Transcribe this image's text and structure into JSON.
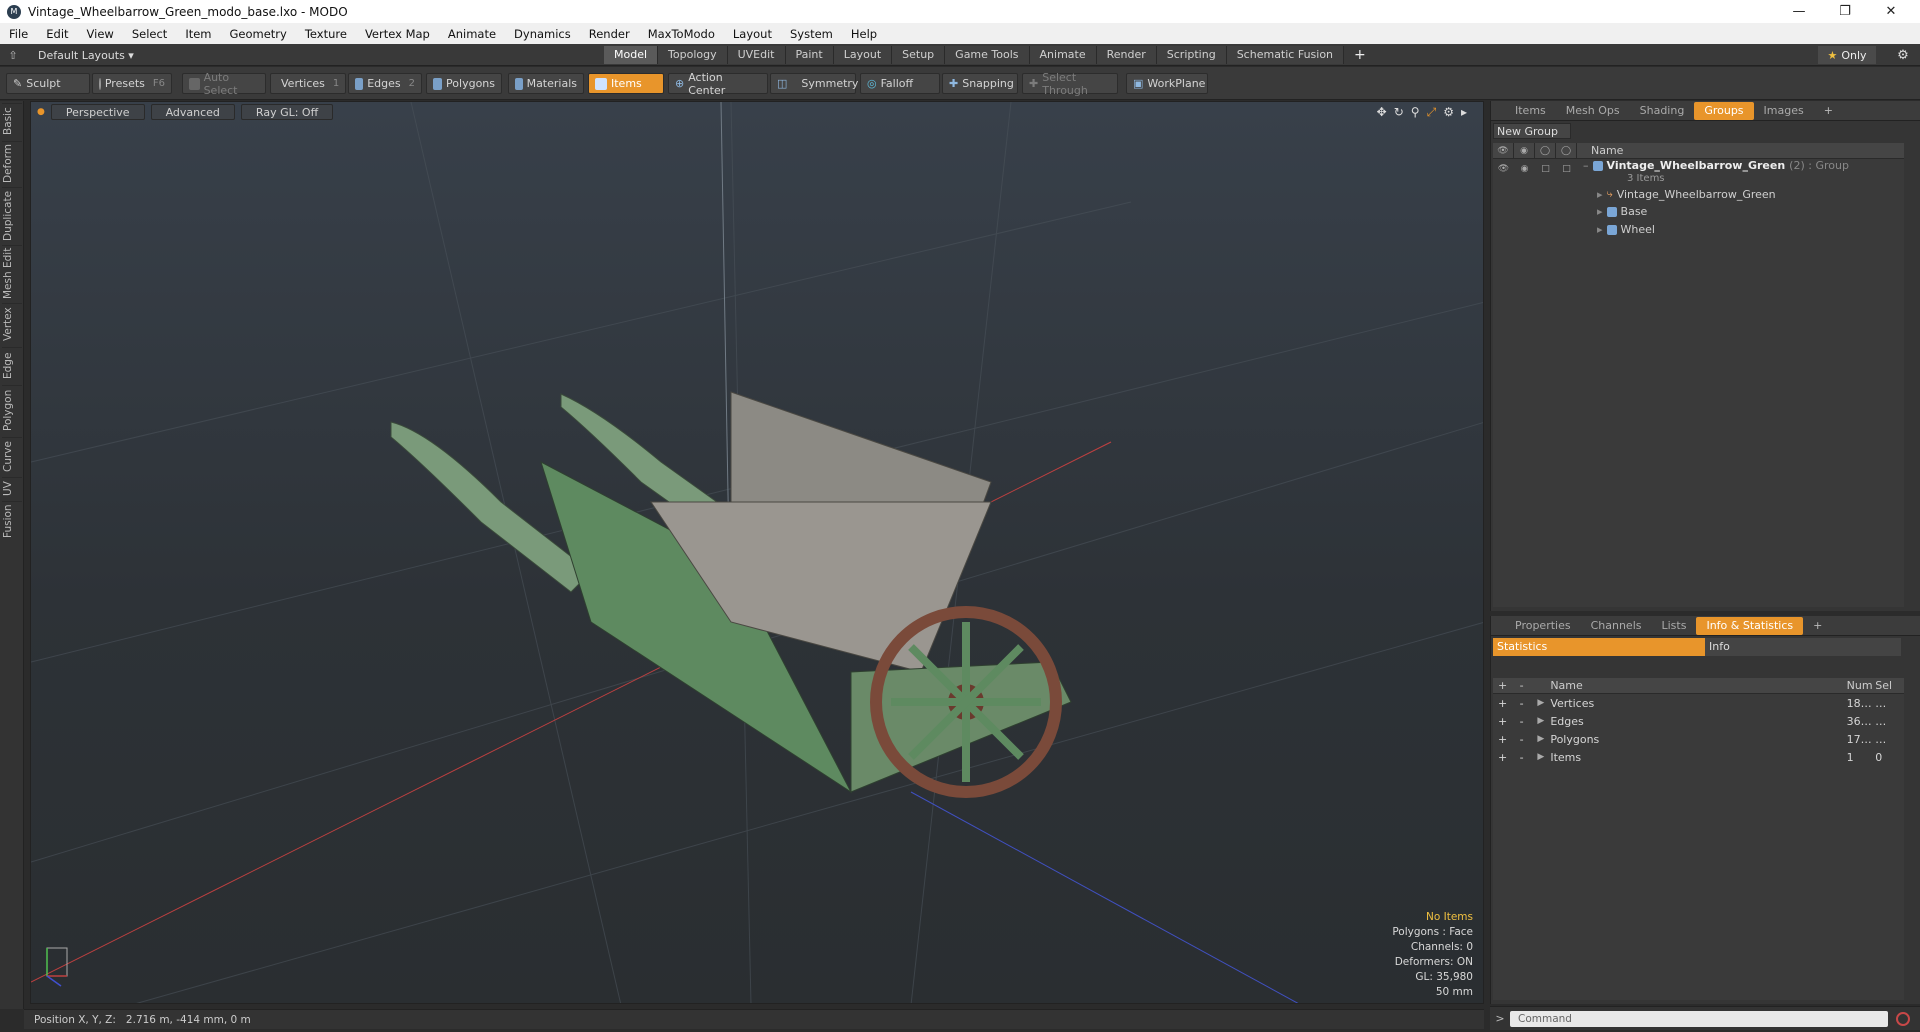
{
  "window": {
    "title": "Vintage_Wheelbarrow_Green_modo_base.lxo - MODO",
    "app_icon": "modo-logo-icon"
  },
  "menu": [
    "File",
    "Edit",
    "View",
    "Select",
    "Item",
    "Geometry",
    "Texture",
    "Vertex Map",
    "Animate",
    "Dynamics",
    "Render",
    "MaxToModo",
    "Layout",
    "System",
    "Help"
  ],
  "layouts_label": "Default Layouts ▾",
  "mode_tabs": [
    "Model",
    "Topology",
    "UVEdit",
    "Paint",
    "Layout",
    "Setup",
    "Game Tools",
    "Animate",
    "Render",
    "Scripting",
    "Schematic Fusion"
  ],
  "active_mode_tab": "Model",
  "only_label": "Only",
  "toolbar": {
    "sculpt": "Sculpt",
    "presets": "Presets",
    "presets_key": "F6",
    "auto_select": "Auto Select",
    "vertices": "Vertices",
    "vertices_key": "1",
    "edges": "Edges",
    "edges_key": "2",
    "polygons": "Polygons",
    "materials": "Materials",
    "items": "Items",
    "action_center": "Action Center",
    "symmetry": "Symmetry",
    "falloff": "Falloff",
    "snapping": "Snapping",
    "select_through": "Select Through",
    "workplane": "WorkPlane"
  },
  "left_tabs": [
    "Basic",
    "Deform",
    "Duplicate",
    "Mesh Edit",
    "Vertex",
    "Edge",
    "Polygon",
    "Curve",
    "UV",
    "Fusion"
  ],
  "viewport": {
    "view_label": "Perspective",
    "shading_label": "Advanced",
    "raygl_label": "Ray GL: Off",
    "hud": {
      "items": "No Items",
      "polygons": "Polygons : Face",
      "channels": "Channels: 0",
      "deformers": "Deformers: ON",
      "gl": "GL: 35,980",
      "focal": "50 mm"
    }
  },
  "status": {
    "label": "Position X, Y, Z:",
    "value": "2.716 m, -414 mm, 0 m"
  },
  "top_panel": {
    "tabs": [
      "Items",
      "Mesh Ops",
      "Shading",
      "Groups",
      "Images"
    ],
    "active_tab": "Groups",
    "new_group": "New Group",
    "name_header": "Name",
    "group_name": "Vintage_Wheelbarrow_Green",
    "group_suffix": "(2) : Group",
    "group_count": "3 Items",
    "children": [
      "Vintage_Wheelbarrow_Green",
      "Base",
      "Wheel"
    ]
  },
  "bottom_panel": {
    "tabs": [
      "Properties",
      "Channels",
      "Lists",
      "Info & Statistics"
    ],
    "active_tab": "Info & Statistics",
    "sub_tabs": [
      "Statistics",
      "Info"
    ],
    "headers": {
      "name": "Name",
      "num": "Num",
      "sel": "Sel"
    },
    "rows": [
      {
        "name": "Vertices",
        "num": "18…",
        "sel": "…"
      },
      {
        "name": "Edges",
        "num": "36…",
        "sel": "…"
      },
      {
        "name": "Polygons",
        "num": "17…",
        "sel": "…"
      },
      {
        "name": "Items",
        "num": "1",
        "sel": "0"
      }
    ]
  },
  "command_placeholder": "Command",
  "colors": {
    "accent": "#e8952b",
    "hud_warn": "#f0c040",
    "wheelbarrow": "#5e8a60"
  }
}
